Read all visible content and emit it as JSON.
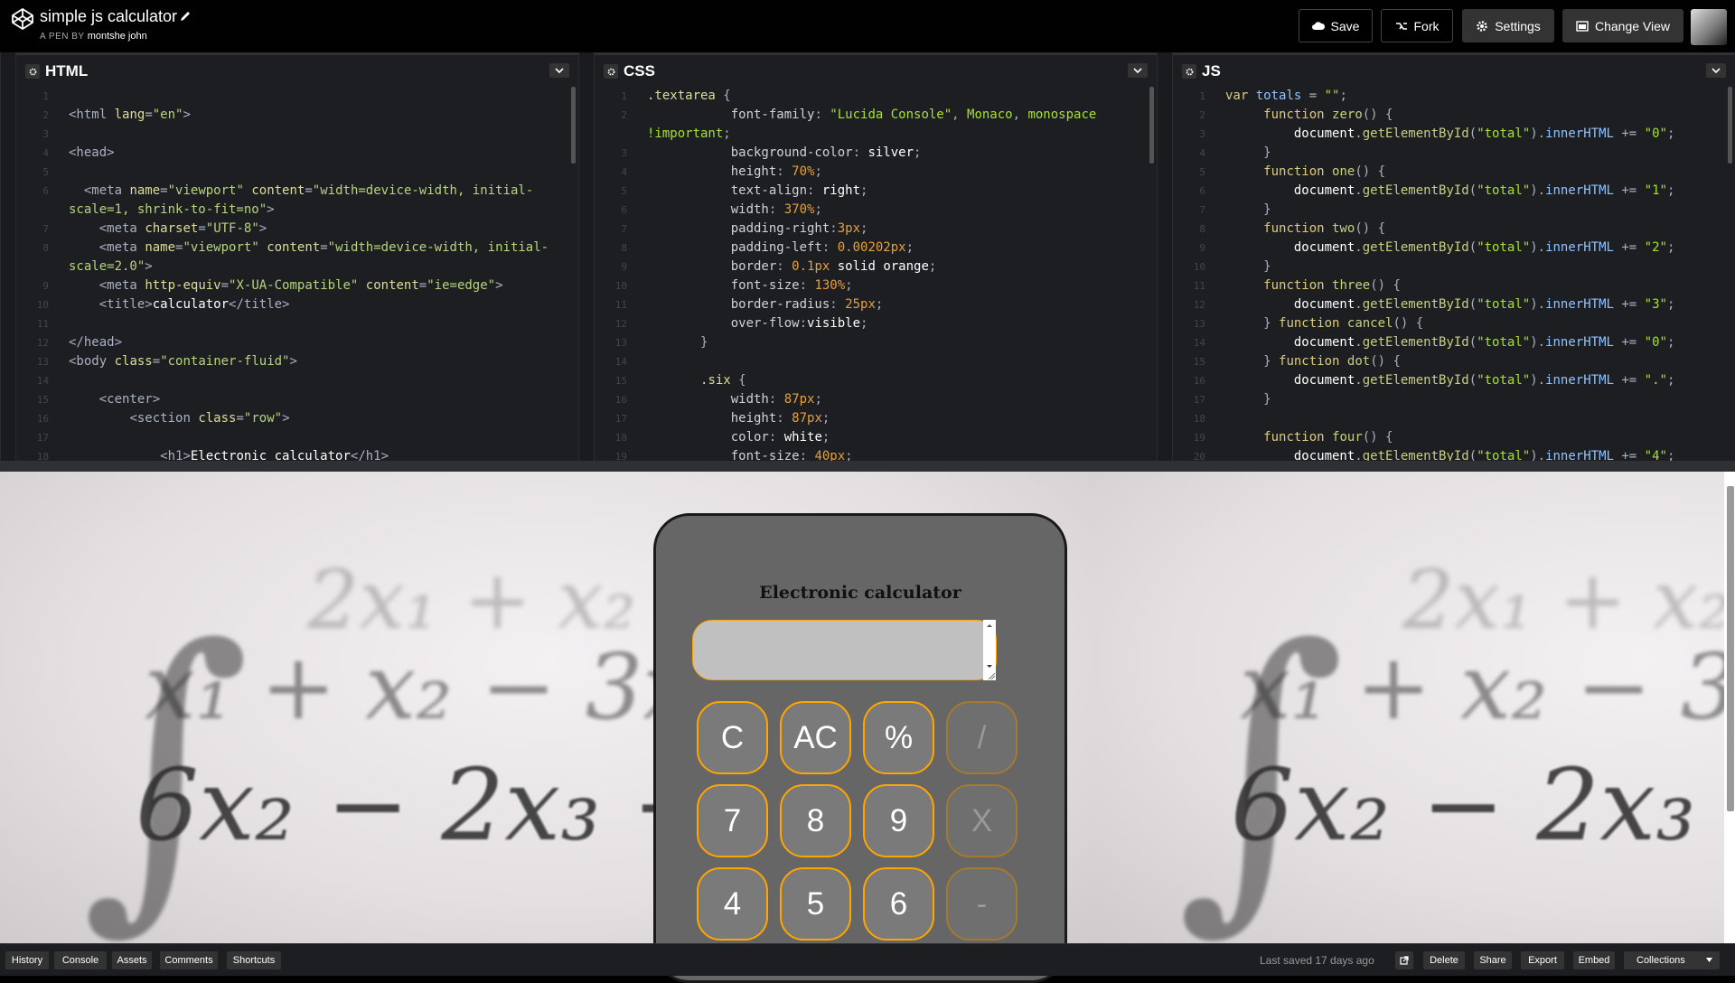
{
  "header": {
    "title": "simple js calculator",
    "pen_by_label": "A PEN BY",
    "author": "montshe john",
    "buttons": {
      "save": "Save",
      "fork": "Fork",
      "settings": "Settings",
      "change_view": "Change View"
    }
  },
  "editors": {
    "html": {
      "label": "HTML",
      "lines": [
        {
          "n": "1",
          "html": ""
        },
        {
          "n": "2",
          "html": "<span class='t-tag'>&lt;html</span> <span class='t-attr'>lang</span>=<span class='t-str2'>\"en\"</span><span class='t-tag'>&gt;</span>"
        },
        {
          "n": "3",
          "html": ""
        },
        {
          "n": "4",
          "html": "<span class='t-tag'>&lt;head&gt;</span>"
        },
        {
          "n": "5",
          "html": ""
        },
        {
          "n": "6",
          "html": "  <span class='t-tag'>&lt;meta</span> <span class='t-attr'>name</span>=<span class='t-str2'>\"viewport\"</span> <span class='t-attr'>content</span>=<span class='t-str2'>\"width=device-width, initial-</span>"
        },
        {
          "n": "",
          "html": "<span class='t-str2'>scale=1, shrink-to-fit=no\"</span><span class='t-tag'>&gt;</span>"
        },
        {
          "n": "7",
          "html": "    <span class='t-tag'>&lt;meta</span> <span class='t-attr'>charset</span>=<span class='t-str2'>\"UTF-8\"</span><span class='t-tag'>&gt;</span>"
        },
        {
          "n": "8",
          "html": "    <span class='t-tag'>&lt;meta</span> <span class='t-attr'>name</span>=<span class='t-str2'>\"viewport\"</span> <span class='t-attr'>content</span>=<span class='t-str2'>\"width=device-width, initial-</span>"
        },
        {
          "n": "",
          "html": "<span class='t-str2'>scale=2.0\"</span><span class='t-tag'>&gt;</span>"
        },
        {
          "n": "9",
          "html": "    <span class='t-tag'>&lt;meta</span> <span class='t-attr'>http-equiv</span>=<span class='t-str2'>\"X-UA-Compatible\"</span> <span class='t-attr'>content</span>=<span class='t-str2'>\"ie=edge\"</span><span class='t-tag'>&gt;</span>"
        },
        {
          "n": "10",
          "html": "    <span class='t-tag'>&lt;title&gt;</span><span class='t-val'>calculator</span><span class='t-tag'>&lt;/title&gt;</span>"
        },
        {
          "n": "11",
          "html": ""
        },
        {
          "n": "12",
          "html": "<span class='t-tag'>&lt;/head&gt;</span>"
        },
        {
          "n": "13",
          "html": "<span class='t-tag'>&lt;body</span> <span class='t-attr'>class</span>=<span class='t-str2'>\"container-fluid\"</span><span class='t-tag'>&gt;</span>"
        },
        {
          "n": "14",
          "html": ""
        },
        {
          "n": "15",
          "html": "    <span class='t-tag'>&lt;center&gt;</span>"
        },
        {
          "n": "16",
          "html": "        <span class='t-tag'>&lt;section</span> <span class='t-attr'>class</span>=<span class='t-str2'>\"row\"</span><span class='t-tag'>&gt;</span>"
        },
        {
          "n": "17",
          "html": ""
        },
        {
          "n": "18",
          "html": "            <span class='t-tag'>&lt;h1&gt;</span><span class='t-val'>Electronic calculator</span><span class='t-tag'>&lt;/h1&gt;</span>"
        }
      ]
    },
    "css": {
      "label": "CSS",
      "lines": [
        {
          "n": "1",
          "html": "<span class='t-sel'>.textarea</span> {"
        },
        {
          "n": "2",
          "html": "           <span class='t-prop'>font-family</span>: <span class='t-str'>\"Lucida Console\"</span>, <span class='t-str'>Monaco</span>, <span class='t-str'>monospace</span>"
        },
        {
          "n": "",
          "html": "<span class='t-str'>!important</span>;"
        },
        {
          "n": "3",
          "html": "           <span class='t-prop'>background-color</span>: <span class='t-val'>silver</span>;"
        },
        {
          "n": "4",
          "html": "           <span class='t-prop'>height</span>: <span class='t-num'>70%</span>;"
        },
        {
          "n": "5",
          "html": "           <span class='t-prop'>text-align</span>: <span class='t-val'>right</span>;"
        },
        {
          "n": "6",
          "html": "           <span class='t-prop'>width</span>: <span class='t-num'>370%</span>;"
        },
        {
          "n": "7",
          "html": "           <span class='t-prop'>padding-right</span>:<span class='t-num'>3px</span>;"
        },
        {
          "n": "8",
          "html": "           <span class='t-prop'>padding-left</span>: <span class='t-num'>0.00202px</span>;"
        },
        {
          "n": "9",
          "html": "           <span class='t-prop'>border</span>: <span class='t-num'>0.1px</span> <span class='t-val'>solid orange</span>;"
        },
        {
          "n": "10",
          "html": "           <span class='t-prop'>font-size</span>: <span class='t-num'>130%</span>;"
        },
        {
          "n": "11",
          "html": "           <span class='t-prop'>border-radius</span>: <span class='t-num'>25px</span>;"
        },
        {
          "n": "12",
          "html": "           <span class='t-prop'>over-flow</span>:<span class='t-val'>visible</span>;"
        },
        {
          "n": "13",
          "html": "       }"
        },
        {
          "n": "14",
          "html": ""
        },
        {
          "n": "15",
          "html": "       <span class='t-sel'>.six</span> {"
        },
        {
          "n": "16",
          "html": "           <span class='t-prop'>width</span>: <span class='t-num'>87px</span>;"
        },
        {
          "n": "17",
          "html": "           <span class='t-prop'>height</span>: <span class='t-num'>87px</span>;"
        },
        {
          "n": "18",
          "html": "           <span class='t-prop'>color</span>: <span class='t-val'>white</span>;"
        },
        {
          "n": "19",
          "html": "           <span class='t-prop'>font-size</span>: <span class='t-num'>40px</span>;"
        }
      ]
    },
    "js": {
      "label": "JS",
      "lines": [
        {
          "n": "1",
          "html": "<span class='t-kw'>var</span> <span class='t-id'>totals</span> = <span class='t-str'>\"\"</span>;"
        },
        {
          "n": "2",
          "html": "     <span class='t-kw'>function</span> <span class='t-fn'>zero</span>() {"
        },
        {
          "n": "3",
          "html": "         <span class='t-val'>document</span>.<span class='t-fn'>getElementById</span>(<span class='t-str'>\"total\"</span>).<span class='t-id'>innerHTML</span> += <span class='t-str'>\"0\"</span>;"
        },
        {
          "n": "4",
          "html": "     }"
        },
        {
          "n": "5",
          "html": "     <span class='t-kw'>function</span> <span class='t-fn'>one</span>() {"
        },
        {
          "n": "6",
          "html": "         <span class='t-val'>document</span>.<span class='t-fn'>getElementById</span>(<span class='t-str'>\"total\"</span>).<span class='t-id'>innerHTML</span> += <span class='t-str'>\"1\"</span>;"
        },
        {
          "n": "7",
          "html": "     }"
        },
        {
          "n": "8",
          "html": "     <span class='t-kw'>function</span> <span class='t-fn'>two</span>() {"
        },
        {
          "n": "9",
          "html": "         <span class='t-val'>document</span>.<span class='t-fn'>getElementById</span>(<span class='t-str'>\"total\"</span>).<span class='t-id'>innerHTML</span> += <span class='t-str'>\"2\"</span>;"
        },
        {
          "n": "10",
          "html": "     }"
        },
        {
          "n": "11",
          "html": "     <span class='t-kw'>function</span> <span class='t-fn'>three</span>() {"
        },
        {
          "n": "12",
          "html": "         <span class='t-val'>document</span>.<span class='t-fn'>getElementById</span>(<span class='t-str'>\"total\"</span>).<span class='t-id'>innerHTML</span> += <span class='t-str'>\"3\"</span>;"
        },
        {
          "n": "13",
          "html": "     } <span class='t-kw'>function</span> <span class='t-fn'>cancel</span>() {"
        },
        {
          "n": "14",
          "html": "         <span class='t-val'>document</span>.<span class='t-fn'>getElementById</span>(<span class='t-str'>\"total\"</span>).<span class='t-id'>innerHTML</span> += <span class='t-str'>\"0\"</span>;"
        },
        {
          "n": "15",
          "html": "     } <span class='t-kw'>function</span> <span class='t-fn'>dot</span>() {"
        },
        {
          "n": "16",
          "html": "         <span class='t-val'>document</span>.<span class='t-fn'>getElementById</span>(<span class='t-str'>\"total\"</span>).<span class='t-id'>innerHTML</span> += <span class='t-str'>\".\"</span>;"
        },
        {
          "n": "17",
          "html": "     }"
        },
        {
          "n": "18",
          "html": ""
        },
        {
          "n": "19",
          "html": "     <span class='t-kw'>function</span> <span class='t-fn'>four</span>() {"
        },
        {
          "n": "20",
          "html": "         <span class='t-val'>document</span>.<span class='t-fn'>getElementById</span>(<span class='t-str'>\"total\"</span>).<span class='t-id'>innerHTML</span> += <span class='t-str'>\"4\"</span>;"
        }
      ]
    }
  },
  "preview": {
    "calc_title": "Electronic calculator",
    "background_math_line1": "2x₁ + x₂",
    "background_math_line2": "x₁ + x₂ − 3x",
    "background_math_line3": "6x₂ − 2x₃ +",
    "keys": {
      "row1": [
        "C",
        "AC",
        "%",
        "/"
      ],
      "row2": [
        "7",
        "8",
        "9",
        "X"
      ],
      "row3": [
        "4",
        "5",
        "6",
        "-"
      ]
    }
  },
  "footer": {
    "left_buttons": [
      "History",
      "Console",
      "Assets",
      "Comments",
      "Shortcuts"
    ],
    "last_saved": "Last saved 17 days ago",
    "right_buttons": {
      "delete": "Delete",
      "share": "Share",
      "export": "Export",
      "embed": "Embed",
      "collections": "Collections"
    }
  },
  "colors": {
    "accent_orange": "#ffa500",
    "editor_bg": "#1d1e22",
    "header_bg": "#010101"
  }
}
